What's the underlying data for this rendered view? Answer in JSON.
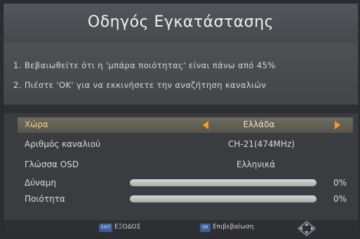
{
  "header": {
    "title": "Οδηγός Εγκατάστασης"
  },
  "instructions": {
    "line1": "1. Βεβαιωθείτε ότι η 'μπάρα ποιότητας' είναι πάνω από 45%",
    "line2": "2. Πιέστε 'OK' για να εκκινήσετε την αναζήτηση καναλιών"
  },
  "settings": {
    "country": {
      "label": "Χώρα",
      "value": "Ελλάδα"
    },
    "channel": {
      "label": "Αριθμός καναλιού",
      "value": "CH-21(474MHz)"
    },
    "osd_language": {
      "label": "Γλώσσα OSD",
      "value": "Ελληνικά"
    },
    "strength": {
      "label": "Δύναμη",
      "percent_text": "0%",
      "level": 0
    },
    "quality": {
      "label": "Ποιότητα",
      "percent_text": "0%",
      "level": 0
    }
  },
  "footer": {
    "exit_key": "EXIT",
    "exit_label": "ΕΞΟΔΟΣ",
    "ok_key": "OK",
    "ok_label": "Επιβεβαίωση"
  },
  "colors": {
    "accent": "#f0a020",
    "highlight_label": "#f1d488",
    "key_button": "#3c5f9a"
  },
  "icons": {
    "left_arrow": "triangle-left",
    "right_arrow": "triangle-right",
    "navigation": "dpad-diamond"
  }
}
